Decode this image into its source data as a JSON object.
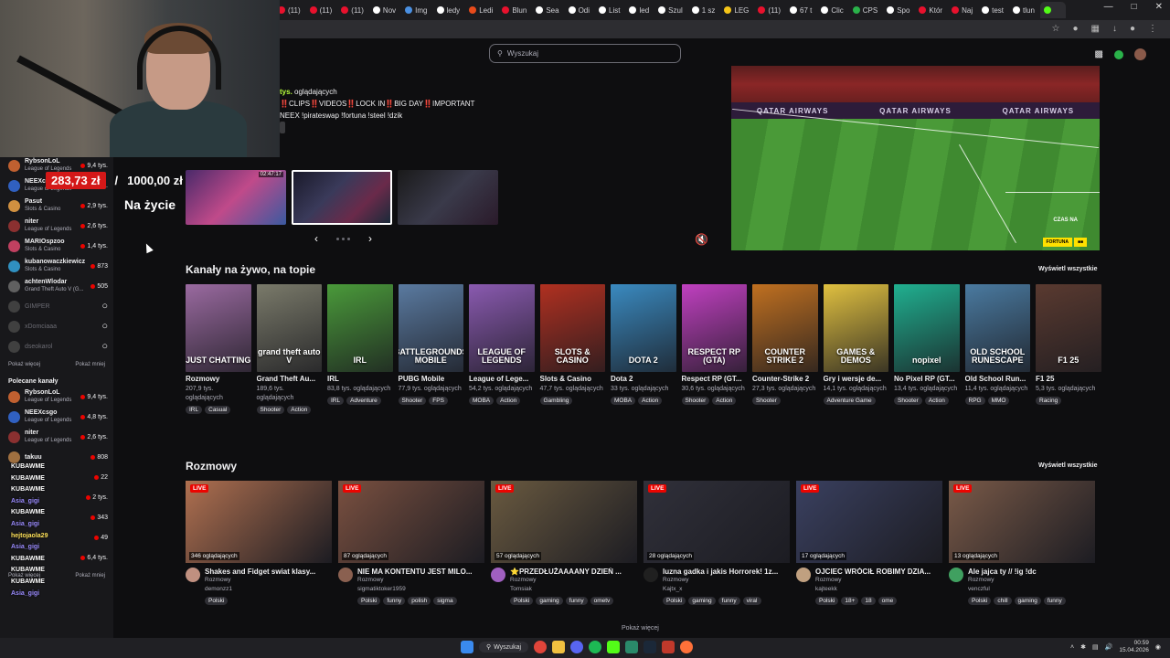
{
  "tabs": [
    {
      "label": "(11)",
      "color": "#e8112d"
    },
    {
      "label": "(11)",
      "color": "#e8112d"
    },
    {
      "label": "(11)",
      "color": "#e8112d"
    },
    {
      "label": "Nov",
      "color": "#ffffff"
    },
    {
      "label": "Img",
      "color": "#4a90e2"
    },
    {
      "label": "ledy",
      "color": "#ffffff"
    },
    {
      "label": "Ledi",
      "color": "#e94b1b"
    },
    {
      "label": "Blun",
      "color": "#e8112d"
    },
    {
      "label": "Sea",
      "color": "#ffffff"
    },
    {
      "label": "Odi",
      "color": "#ffffff"
    },
    {
      "label": "List",
      "color": "#ffffff"
    },
    {
      "label": "led",
      "color": "#ffffff"
    },
    {
      "label": "Szul",
      "color": "#ffffff"
    },
    {
      "label": "1 sz",
      "color": "#ffffff"
    },
    {
      "label": "LEG",
      "color": "#f5c518"
    },
    {
      "label": "(11)",
      "color": "#e8112d"
    },
    {
      "label": "67 t",
      "color": "#ffffff"
    },
    {
      "label": "Clic",
      "color": "#ffffff"
    },
    {
      "label": "CPS",
      "color": "#2ab24a"
    },
    {
      "label": "Spo",
      "color": "#ffffff"
    },
    {
      "label": "Któr",
      "color": "#e8112d"
    },
    {
      "label": "Naj",
      "color": "#e8112d"
    },
    {
      "label": "test",
      "color": "#ffffff"
    },
    {
      "label": "tlun",
      "color": "#ffffff"
    },
    {
      "label": "",
      "color": "#53fc18",
      "active": true
    }
  ],
  "search": {
    "placeholder": "Wyszukaj"
  },
  "sidebar": {
    "followed": [
      {
        "name": "RybsonLoL",
        "game": "League of Legends",
        "viewers": "9,4 tys.",
        "color": "#c06030"
      },
      {
        "name": "NEEXcsgo",
        "game": "League of Legends",
        "viewers": "4,8 tys.",
        "color": "#3060c0"
      },
      {
        "name": "Pasut",
        "game": "Slots & Casino",
        "viewers": "2,9 tys.",
        "color": "#d09040"
      },
      {
        "name": "niter",
        "game": "League of Legends",
        "viewers": "2,6 tys.",
        "color": "#8a3030"
      },
      {
        "name": "MARIOspzoo",
        "game": "Slots & Casino",
        "viewers": "1,4 tys.",
        "color": "#c04060"
      },
      {
        "name": "kubanowaczkiewicz",
        "game": "Slots & Casino",
        "viewers": "873",
        "color": "#3090c0"
      },
      {
        "name": "achtenWlodar",
        "game": "Grand Theft Auto V (G...",
        "viewers": "505",
        "color": "#606060"
      }
    ],
    "offline": [
      {
        "name": "GIMPER",
        "color": "#404040"
      },
      {
        "name": "xDomciaaa",
        "color": "#404040"
      },
      {
        "name": "dseokarol",
        "color": "#404040"
      }
    ],
    "show_more": "Pokaż więcej",
    "show_less": "Pokaż mniej",
    "recommended_title": "Polecane kanały",
    "recommended": [
      {
        "name": "RybsonLoL",
        "game": "League of Legends",
        "viewers": "9,4 tys.",
        "color": "#c06030"
      },
      {
        "name": "NEEXcsgo",
        "game": "League of Legends",
        "viewers": "4,8 tys.",
        "color": "#3060c0"
      },
      {
        "name": "niter",
        "game": "League of Legends",
        "viewers": "2,6 tys.",
        "color": "#8a3030"
      },
      {
        "name": "takuu",
        "game": "",
        "viewers": "808",
        "color": "#a07040"
      }
    ],
    "recommended_viewers_extra": [
      "22",
      "2 tys.",
      "343",
      "49",
      "6,4 tys."
    ],
    "show_more2": "Pokaż więcej",
    "show_less2": "Pokaż mniej"
  },
  "chat_overlay": [
    {
      "text": "KUBAWME",
      "cls": ""
    },
    {
      "text": "KUBAWME",
      "cls": ""
    },
    {
      "text": "KUBAWME",
      "cls": ""
    },
    {
      "text": "Asia_gigi",
      "cls": "purple"
    },
    {
      "text": "KUBAWME",
      "cls": ""
    },
    {
      "text": "Asia_gigi",
      "cls": "purple"
    },
    {
      "text": "hejtojaola29",
      "cls": "yellow"
    },
    {
      "text": "Asia_gigi",
      "cls": "purple"
    },
    {
      "text": "KUBAWME",
      "cls": ""
    },
    {
      "text": "KUBAWME",
      "cls": ""
    },
    {
      "text": "KUBAWME",
      "cls": ""
    },
    {
      "text": "Asia_gigi",
      "cls": "purple"
    }
  ],
  "overlay": {
    "donate_current": "283,73 zł",
    "donate_sep": "/",
    "donate_goal": "1000,00 zł",
    "live_label": "Na życie"
  },
  "hero": {
    "viewers_short": "tys.",
    "viewers_suffix": "oglądających",
    "line1": "‼️CLIPS‼️VIDEOS‼️LOCK IN‼️BIG DAY‼️IMPORTANT",
    "line2": "NEEX !pirateswap !fortuna !steel !dzik",
    "thumb_time": "02:47:17",
    "player_banner": [
      "QATAR AIRWAYS",
      "QATAR AIRWAYS",
      "QATAR AIRWAYS"
    ],
    "player_tag": "CZAS NA",
    "player_sponsor": "FORTUNA"
  },
  "categories_section": {
    "title": "Kanały na żywo, na topie",
    "see_all": "Wyświetl wszystkie",
    "items": [
      {
        "name": "Rozmowy",
        "art": "JUST CHATTING",
        "viewers": "207,9 tys. oglądających",
        "tags": [
          "IRL",
          "Casual"
        ],
        "bg": "#9a6aa0"
      },
      {
        "name": "Grand Theft Au...",
        "art": "grand theft auto V",
        "viewers": "189,6 tys. oglądających",
        "tags": [
          "Shooter",
          "Action"
        ],
        "bg": "#7a7a6a"
      },
      {
        "name": "IRL",
        "art": "IRL",
        "viewers": "83,8 tys. oglądających",
        "tags": [
          "IRL",
          "Adventure"
        ],
        "bg": "#4a9a3a"
      },
      {
        "name": "PUBG Mobile",
        "art": "BATTLEGROUNDS MOBILE",
        "viewers": "77,9 tys. oglądających",
        "tags": [
          "Shooter",
          "FPS"
        ],
        "bg": "#5a7aa0"
      },
      {
        "name": "League of Lege...",
        "art": "LEAGUE OF LEGENDS",
        "viewers": "54,2 tys. oglądających",
        "tags": [
          "MOBA",
          "Action"
        ],
        "bg": "#8a5ab0"
      },
      {
        "name": "Slots & Casino",
        "art": "SLOTS & CASINO",
        "viewers": "47,7 tys. oglądających",
        "tags": [
          "Gambling"
        ],
        "bg": "#b03020"
      },
      {
        "name": "Dota 2",
        "art": "DOTA 2",
        "viewers": "33 tys. oglądających",
        "tags": [
          "MOBA",
          "Action"
        ],
        "bg": "#3a8ac0"
      },
      {
        "name": "Respect RP (GT...",
        "art": "RESPECT RP (GTA)",
        "viewers": "30,6 tys. oglądających",
        "tags": [
          "Shooter",
          "Action"
        ],
        "bg": "#c040c0"
      },
      {
        "name": "Counter-Strike 2",
        "art": "COUNTER STRIKE 2",
        "viewers": "27,3 tys. oglądających",
        "tags": [
          "Shooter"
        ],
        "bg": "#c07020"
      },
      {
        "name": "Gry i wersje de...",
        "art": "GAMES & DEMOS",
        "viewers": "14,1 tys. oglądających",
        "tags": [
          "Adventure Game"
        ],
        "bg": "#e0c040"
      },
      {
        "name": "No Pixel RP (GT...",
        "art": "nopixel",
        "viewers": "13,4 tys. oglądających",
        "tags": [
          "Shooter",
          "Action"
        ],
        "bg": "#20b090"
      },
      {
        "name": "Old School Run...",
        "art": "OLD SCHOOL RUNESCAPE",
        "viewers": "11,4 tys. oglądających",
        "tags": [
          "RPG",
          "MMO"
        ],
        "bg": "#4a7aa0"
      },
      {
        "name": "F1 25",
        "art": "F1 25",
        "viewers": "5,3 tys. oglądających",
        "tags": [
          "Racing"
        ],
        "bg": "#5a3a30"
      }
    ]
  },
  "streams_section": {
    "title": "Rozmowy",
    "see_all": "Wyświetl wszystkie",
    "live_label": "LIVE",
    "items": [
      {
        "viewers": "346 oglądających",
        "title": "Shakes and Fidget swiat klasy...",
        "category": "Rozmowy",
        "channel": "demonzz1",
        "tags": [
          "Polski"
        ],
        "bg": "#b07050",
        "av": "#c09080"
      },
      {
        "viewers": "87 oglądających",
        "title": "NIE MA KONTENTU JEST MILO...",
        "category": "Rozmowy",
        "channel": "sigmatiktoker1959",
        "tags": [
          "Polski",
          "funny",
          "polish",
          "sigma"
        ],
        "bg": "#7a5040",
        "av": "#8a6050"
      },
      {
        "viewers": "57 oglądających",
        "title": "⭐PRZEDŁUŻAAAANY DZIEŃ ...",
        "category": "Rozmowy",
        "channel": "Tomsiak",
        "tags": [
          "Polski",
          "gaming",
          "funny",
          "ometv"
        ],
        "bg": "#6a5a40",
        "av": "#a060c0"
      },
      {
        "viewers": "28 oglądających",
        "title": "luzna gadka i jakis Horrorek! 1z...",
        "category": "Rozmowy",
        "channel": "Kajtx_x",
        "tags": [
          "Polski",
          "gaming",
          "funny",
          "viral"
        ],
        "bg": "#30303a",
        "av": "#202020"
      },
      {
        "viewers": "17 oglądających",
        "title": "OJCIEC WRÓCIŁ ROBIMY DZIA...",
        "category": "Rozmowy",
        "channel": "kajteekk",
        "tags": [
          "Polski",
          "18+",
          "18",
          "ome"
        ],
        "bg": "#3a4060",
        "av": "#c0a080"
      },
      {
        "viewers": "13 oglądających",
        "title": "Ale jajca ty // !ig !dc",
        "category": "Rozmowy",
        "channel": "venczful",
        "tags": [
          "Polski",
          "chill",
          "gaming",
          "funny"
        ],
        "bg": "#7a5a48",
        "av": "#40a060"
      }
    ]
  },
  "show_more_bottom": "Pokaż więcej",
  "taskbar": {
    "search": "Wyszukaj",
    "time": "00:59",
    "date": "15.04.2026"
  }
}
